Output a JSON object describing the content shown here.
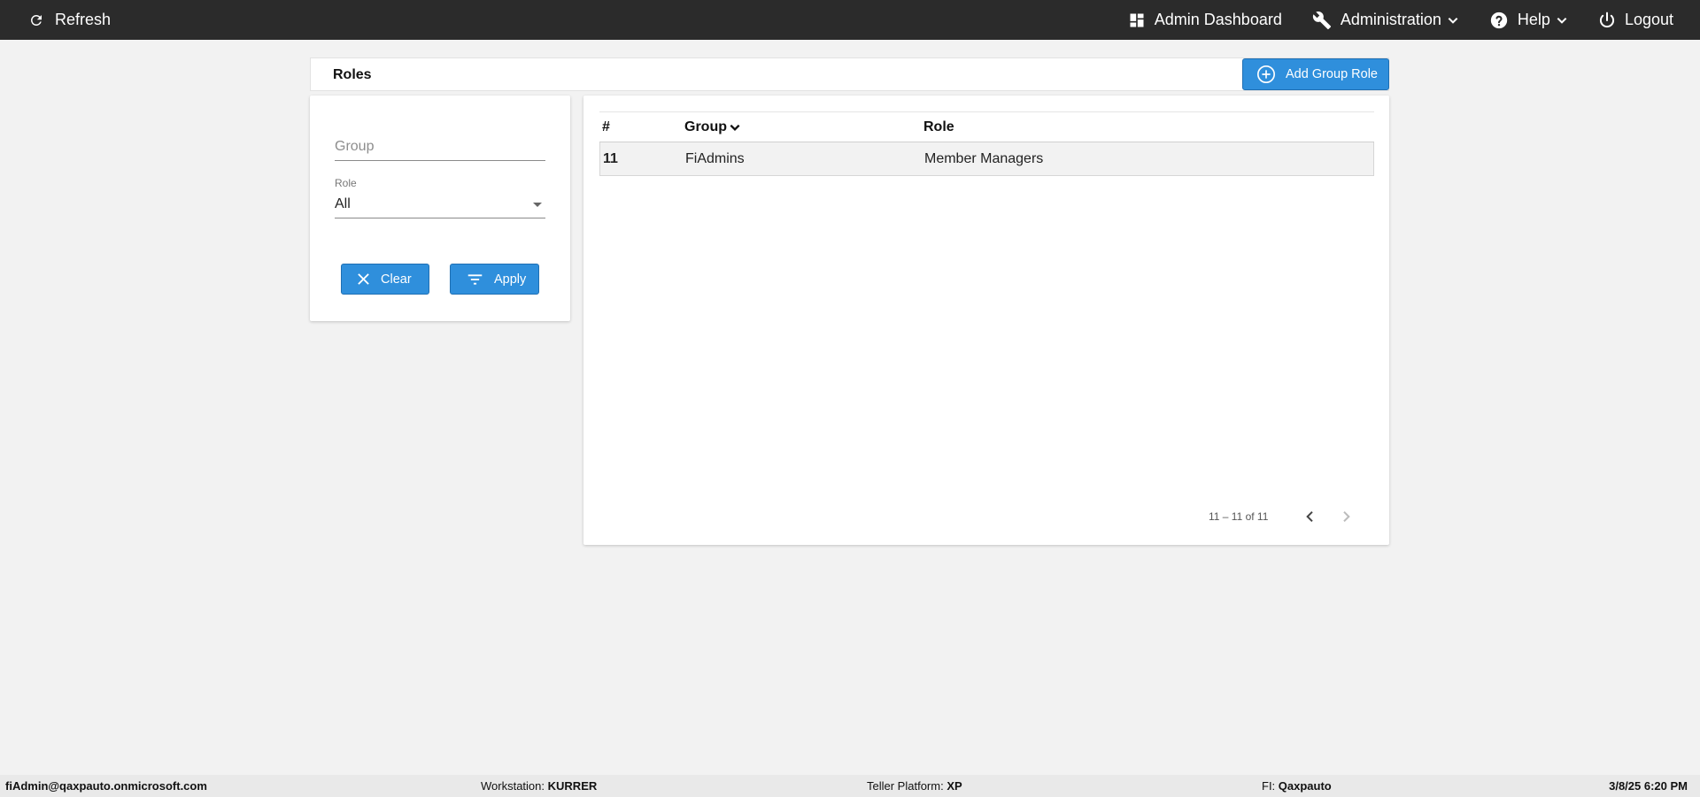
{
  "topbar": {
    "refresh_label": "Refresh",
    "admin_dashboard_label": "Admin Dashboard",
    "administration_label": "Administration",
    "help_label": "Help",
    "logout_label": "Logout"
  },
  "page": {
    "title": "Roles",
    "add_button_label": "Add Group Role"
  },
  "filters": {
    "group_placeholder": "Group",
    "group_value": "",
    "role_label": "Role",
    "role_value": "All",
    "clear_label": "Clear",
    "apply_label": "Apply"
  },
  "table": {
    "columns": [
      "#",
      "Group",
      "Role"
    ],
    "rows": [
      {
        "id": "11",
        "group": "FiAdmins",
        "role": "Member Managers"
      }
    ],
    "pagination": "11 – 11 of 11"
  },
  "footer": {
    "user": "fiAdmin@qaxpauto.onmicrosoft.com",
    "workstation_label": "Workstation:",
    "workstation_value": "KURRER",
    "teller_label": "Teller Platform:",
    "teller_value": "XP",
    "fi_label": "FI:",
    "fi_value": "Qaxpauto",
    "datetime": "3/8/25 6:20 PM"
  },
  "icons": {
    "refresh": "refresh-icon",
    "dashboard": "dashboard-icon",
    "wrench": "wrench-icon",
    "help": "help-circle-icon",
    "power": "power-icon",
    "add": "add-circle-icon",
    "close": "close-icon",
    "filter": "filter-icon"
  },
  "colors": {
    "topbar": "#2b2b2b",
    "accent": "#2f8fdc",
    "background": "#f2f2f2"
  }
}
